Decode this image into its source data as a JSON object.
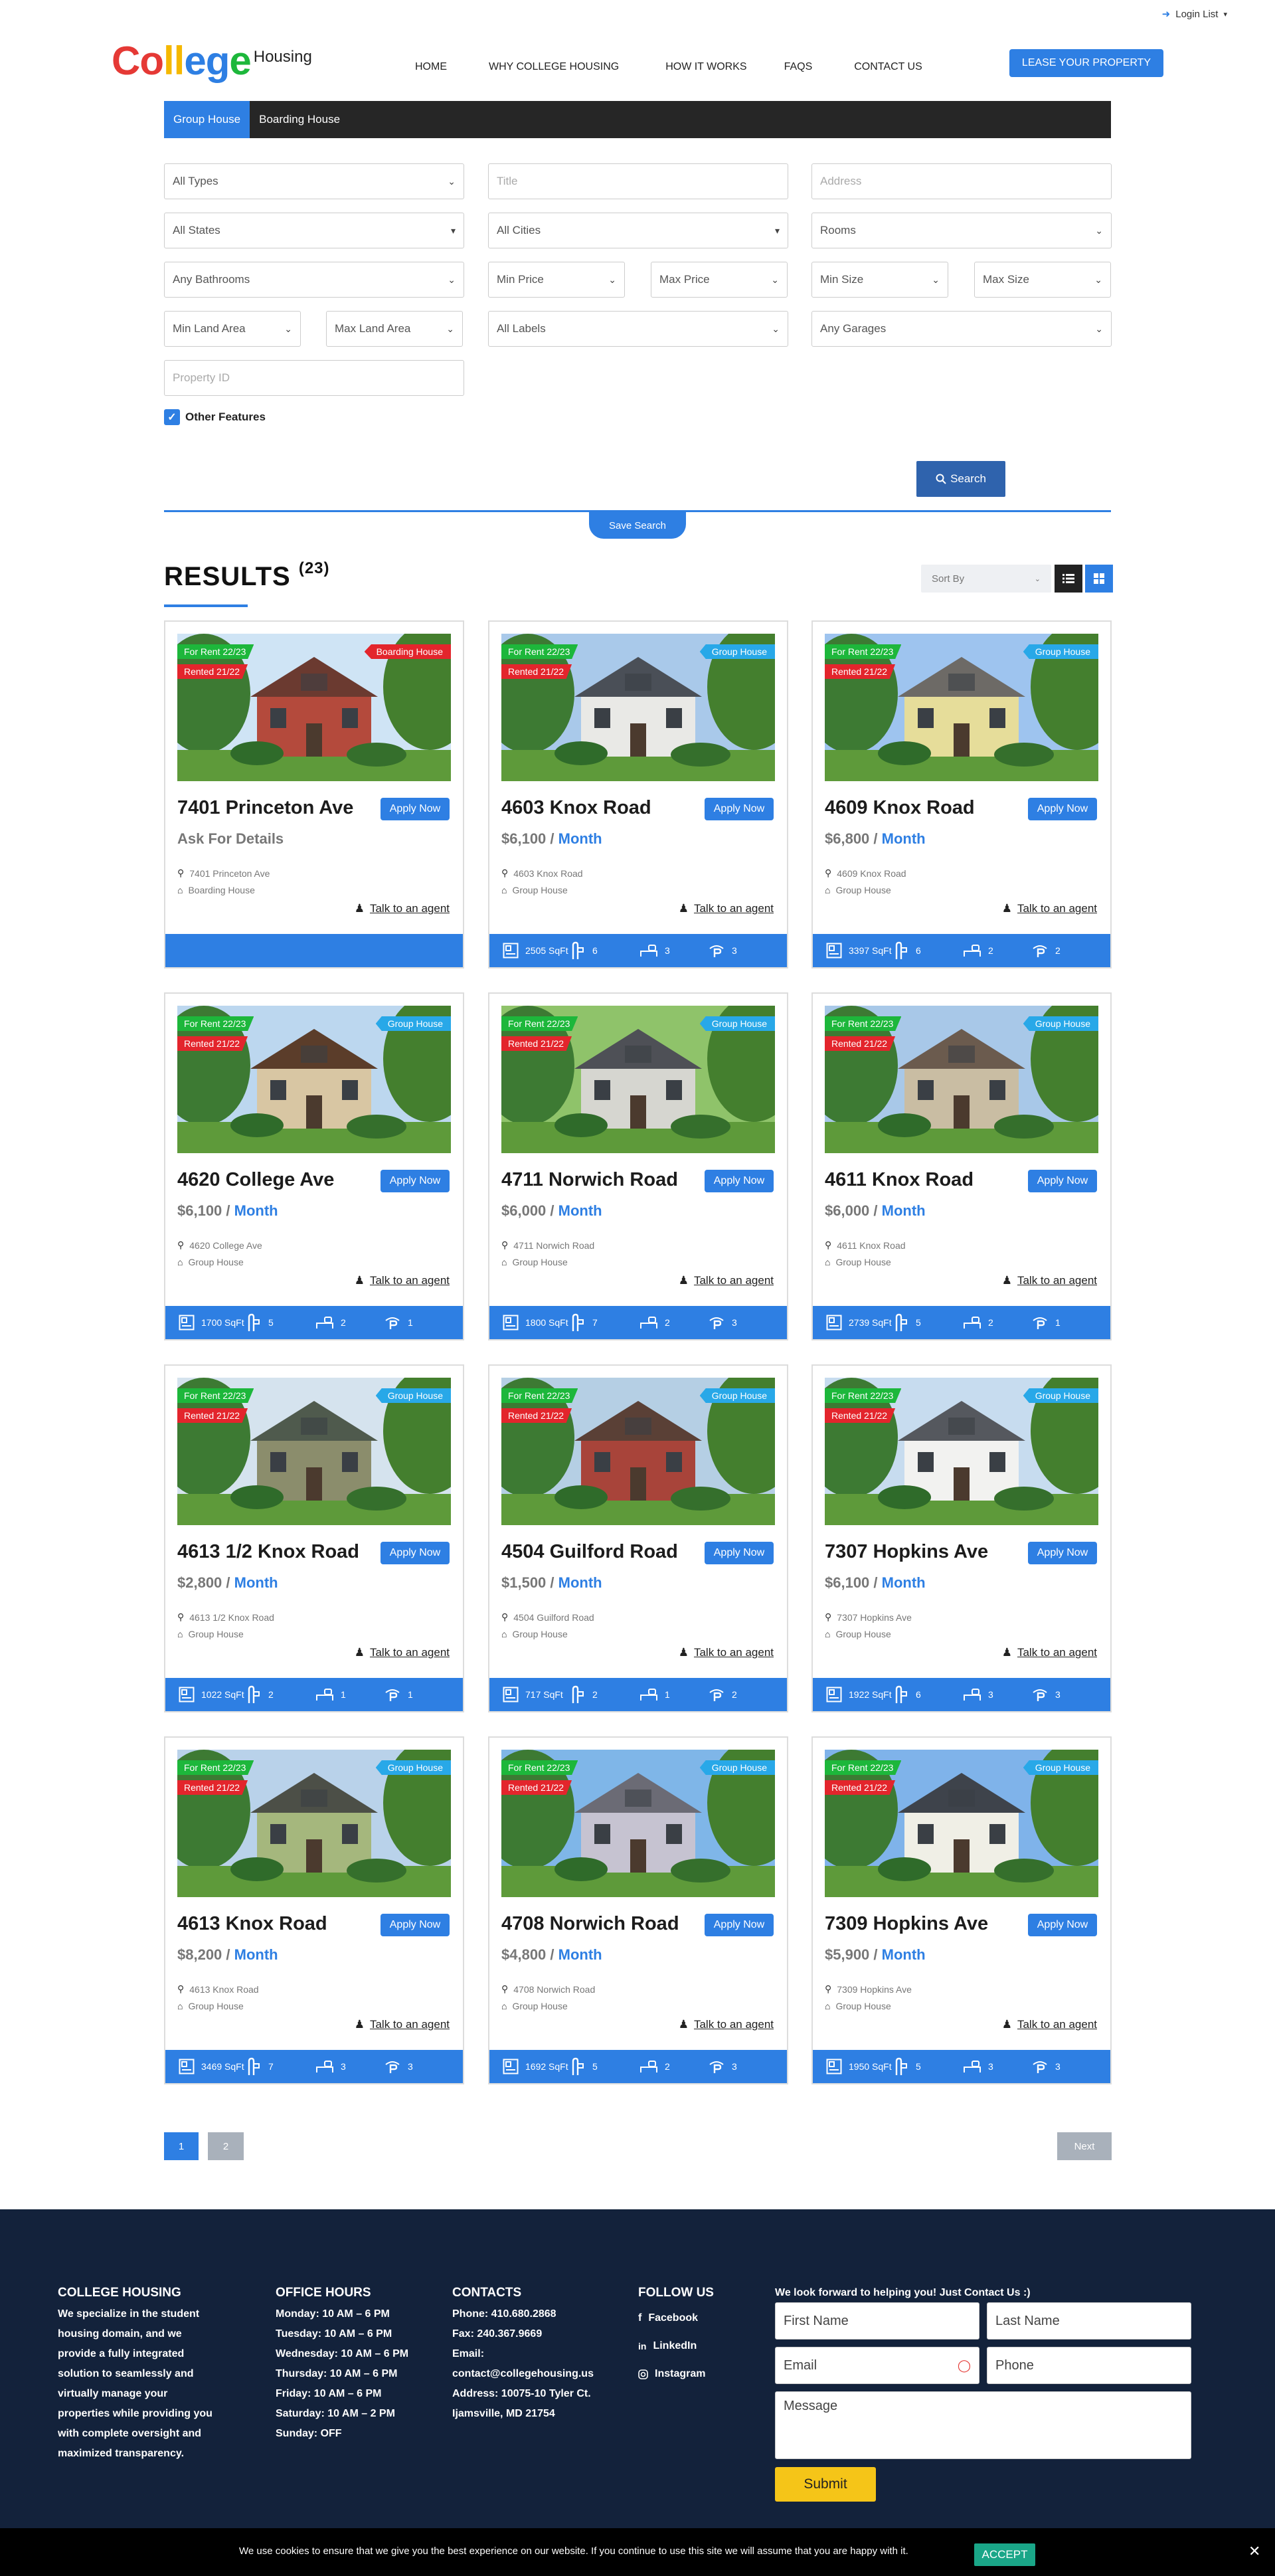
{
  "topbar": {
    "login": "Login List"
  },
  "logo": {
    "letters": [
      "C",
      "o",
      "l",
      "l",
      "e",
      "g",
      "e"
    ],
    "letter_colors": [
      "#e53935",
      "#e53935",
      "#f5b800",
      "#f5b800",
      "#2e7fe3",
      "#2e7fe3",
      "#1db73b"
    ],
    "housing": "Housing"
  },
  "nav": {
    "items": [
      "HOME",
      "WHY COLLEGE HOUSING",
      "HOW IT WORKS",
      "FAQS",
      "CONTACT US"
    ],
    "lease_button": "LEASE YOUR PROPERTY"
  },
  "search": {
    "tabs": [
      "Group House",
      "Boarding House"
    ],
    "fields": {
      "types": "All Types",
      "title": "Title",
      "address": "Address",
      "states": "All States",
      "cities": "All Cities",
      "rooms": "Rooms",
      "bathrooms": "Any Bathrooms",
      "min_price": "Min Price",
      "max_price": "Max Price",
      "min_size": "Min Size",
      "max_size": "Max Size",
      "min_land": "Min Land Area",
      "max_land": "Max Land Area",
      "labels": "All Labels",
      "garages": "Any Garages",
      "property_id": "Property ID"
    },
    "other_features": "Other Features",
    "search_button": "Search",
    "save_search": "Save Search"
  },
  "results": {
    "title": "RESULTS",
    "count": "(23)",
    "sort_by": "Sort By"
  },
  "colors": {
    "accent": "#2e7fe3",
    "rent_badge": "#1db73b",
    "rented_badge": "#e3252c",
    "boarding_badge": "#e3252c",
    "group_badge": "#28a8e8"
  },
  "cards": [
    {
      "title": "7401 Princeton Ave",
      "price": "Ask For Details",
      "month": "",
      "address": "7401 Princeton Ave",
      "type": "Boarding House",
      "badge": "Boarding House",
      "rent": "For Rent 22/23",
      "rented": "Rented 21/22",
      "apply": "Apply Now",
      "talk": "Talk to an agent",
      "sqft": "",
      "baths": "",
      "beds": "",
      "garages": "",
      "house": 0
    },
    {
      "title": "4603 Knox Road",
      "price": "$6,100 / ",
      "month": "Month",
      "address": "4603 Knox Road",
      "type": "Group House",
      "badge": "Group House",
      "rent": "For Rent 22/23",
      "rented": "Rented 21/22",
      "apply": "Apply Now",
      "talk": "Talk to an agent",
      "sqft": "2505 SqFt",
      "baths": "6",
      "beds": "3",
      "garages": "3",
      "house": 1
    },
    {
      "title": "4609 Knox Road",
      "price": "$6,800 / ",
      "month": "Month",
      "address": "4609 Knox Road",
      "type": "Group House",
      "badge": "Group House",
      "rent": "For Rent 22/23",
      "rented": "Rented 21/22",
      "apply": "Apply Now",
      "talk": "Talk to an agent",
      "sqft": "3397 SqFt",
      "baths": "6",
      "beds": "2",
      "garages": "2",
      "house": 2
    },
    {
      "title": "4620 College Ave",
      "price": "$6,100 / ",
      "month": "Month",
      "address": "4620 College Ave",
      "type": "Group House",
      "badge": "Group House",
      "rent": "For Rent 22/23",
      "rented": "Rented 21/22",
      "apply": "Apply Now",
      "talk": "Talk to an agent",
      "sqft": "1700 SqFt",
      "baths": "5",
      "beds": "2",
      "garages": "1",
      "house": 3
    },
    {
      "title": "4711 Norwich Road",
      "price": "$6,000 / ",
      "month": "Month",
      "address": "4711 Norwich Road",
      "type": "Group House",
      "badge": "Group House",
      "rent": "For Rent 22/23",
      "rented": "Rented 21/22",
      "apply": "Apply Now",
      "talk": "Talk to an agent",
      "sqft": "1800 SqFt",
      "baths": "7",
      "beds": "2",
      "garages": "3",
      "house": 4
    },
    {
      "title": "4611 Knox Road",
      "price": "$6,000 / ",
      "month": "Month",
      "address": "4611 Knox Road",
      "type": "Group House",
      "badge": "Group House",
      "rent": "For Rent 22/23",
      "rented": "Rented 21/22",
      "apply": "Apply Now",
      "talk": "Talk to an agent",
      "sqft": "2739 SqFt",
      "baths": "5",
      "beds": "2",
      "garages": "1",
      "house": 5
    },
    {
      "title": "4613 1/2 Knox Road",
      "price": "$2,800 / ",
      "month": "Month",
      "address": "4613 1/2 Knox Road",
      "type": "Group House",
      "badge": "Group House",
      "rent": "For Rent 22/23",
      "rented": "Rented 21/22",
      "apply": "Apply Now",
      "talk": "Talk to an agent",
      "sqft": "1022 SqFt",
      "baths": "2",
      "beds": "1",
      "garages": "1",
      "house": 6
    },
    {
      "title": "4504 Guilford Road",
      "price": "$1,500 / ",
      "month": "Month",
      "address": "4504 Guilford Road",
      "type": "Group House",
      "badge": "Group House",
      "rent": "For Rent 22/23",
      "rented": "Rented 21/22",
      "apply": "Apply Now",
      "talk": "Talk to an agent",
      "sqft": "717 SqFt",
      "baths": "2",
      "beds": "1",
      "garages": "2",
      "house": 7
    },
    {
      "title": "7307 Hopkins Ave",
      "price": "$6,100 / ",
      "month": "Month",
      "address": "7307 Hopkins Ave",
      "type": "Group House",
      "badge": "Group House",
      "rent": "For Rent 22/23",
      "rented": "Rented 21/22",
      "apply": "Apply Now",
      "talk": "Talk to an agent",
      "sqft": "1922 SqFt",
      "baths": "6",
      "beds": "3",
      "garages": "3",
      "house": 8
    },
    {
      "title": "4613 Knox Road",
      "price": "$8,200 / ",
      "month": "Month",
      "address": "4613 Knox Road",
      "type": "Group House",
      "badge": "Group House",
      "rent": "For Rent 22/23",
      "rented": "Rented 21/22",
      "apply": "Apply Now",
      "talk": "Talk to an agent",
      "sqft": "3469 SqFt",
      "baths": "7",
      "beds": "3",
      "garages": "3",
      "house": 9
    },
    {
      "title": "4708 Norwich Road",
      "price": "$4,800 / ",
      "month": "Month",
      "address": "4708 Norwich Road",
      "type": "Group House",
      "badge": "Group House",
      "rent": "For Rent 22/23",
      "rented": "Rented 21/22",
      "apply": "Apply Now",
      "talk": "Talk to an agent",
      "sqft": "1692 SqFt",
      "baths": "5",
      "beds": "2",
      "garages": "3",
      "house": 10
    },
    {
      "title": "7309 Hopkins Ave",
      "price": "$5,900 / ",
      "month": "Month",
      "address": "7309 Hopkins Ave",
      "type": "Group House",
      "badge": "Group House",
      "rent": "For Rent 22/23",
      "rented": "Rented 21/22",
      "apply": "Apply Now",
      "talk": "Talk to an agent",
      "sqft": "1950 SqFt",
      "baths": "5",
      "beds": "3",
      "garages": "3",
      "house": 11
    }
  ],
  "pagination": {
    "pages": [
      "1",
      "2"
    ],
    "next": "Next"
  },
  "footer": {
    "about_title": "COLLEGE HOUSING",
    "about_text": [
      "We specialize in the student",
      "housing domain, and we",
      "provide a fully integrated",
      "solution to seamlessly and",
      "virtually manage your",
      "properties while providing you",
      "with complete oversight and",
      "maximized transparency."
    ],
    "hours_title": "OFFICE HOURS",
    "hours": [
      "Monday: 10 AM – 6 PM",
      "Tuesday: 10 AM – 6 PM",
      "Wednesday: 10 AM – 6 PM",
      "Thursday: 10 AM – 6 PM",
      "Friday: 10 AM – 6 PM",
      "Saturday: 10 AM – 2 PM",
      "Sunday: OFF"
    ],
    "contacts_title": "CONTACTS",
    "contacts": [
      "Phone: 410.680.2868",
      "Fax: 240.367.9669",
      "Email:",
      "contact@collegehousing.us",
      "Address: 10075-10 Tyler Ct.",
      "Ijamsville, MD 21754"
    ],
    "follow_title": "FOLLOW US",
    "social": [
      "Facebook",
      "LinkedIn",
      "Instagram"
    ],
    "form_title": "We look forward to helping you! Just Contact Us :)",
    "first_name": "First Name",
    "last_name": "Last Name",
    "email": "Email",
    "phone": "Phone",
    "message": "Message",
    "submit": "Submit"
  },
  "cookie": {
    "text": "We use cookies to ensure that we give you the best experience on our website. If you continue to use this site we will assume that you are happy with it.",
    "accept": "ACCEPT"
  }
}
